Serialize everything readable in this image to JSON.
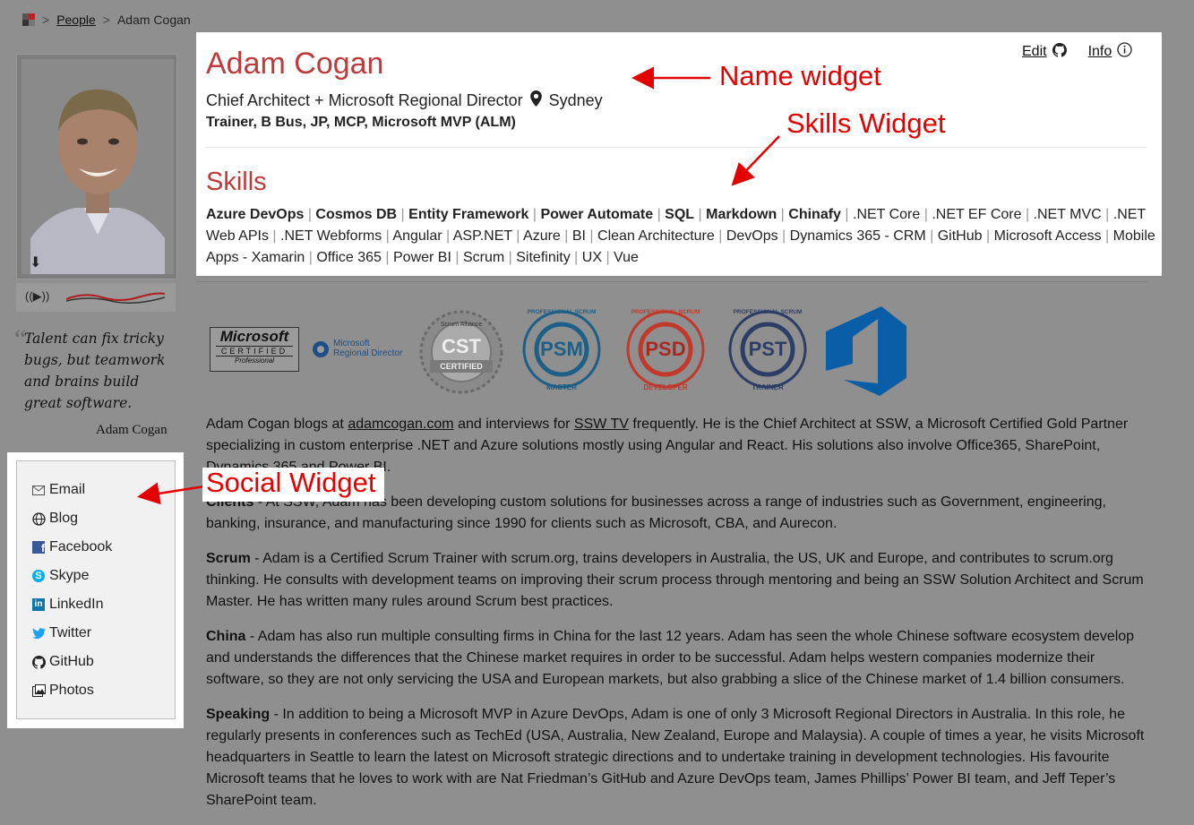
{
  "breadcrumb": {
    "items": [
      "People",
      "Adam Cogan"
    ],
    "separator": ">"
  },
  "profile": {
    "name": "Adam Cogan",
    "role": "Chief Architect + Microsoft Regional Director",
    "location": "Sydney",
    "credentials": "Trainer, B Bus, JP, MCP, Microsoft MVP (ALM)",
    "edit_label": "Edit",
    "info_label": "Info"
  },
  "quote": {
    "text": "Talent can fix tricky bugs, but teamwork and brains build great software.",
    "author": "Adam Cogan"
  },
  "skills": {
    "heading": "Skills",
    "bold_items": [
      "Azure DevOps",
      "Cosmos DB",
      "Entity Framework",
      "Power Automate",
      "SQL",
      "Markdown",
      "Chinafy"
    ],
    "items": [
      ".NET Core",
      ".NET EF Core",
      ".NET MVC",
      ".NET Web APIs",
      ".NET Webforms",
      "Angular",
      "ASP.NET",
      "Azure",
      "BI",
      "Clean Architecture",
      "DevOps",
      "Dynamics 365 - CRM",
      "GitHub",
      "Microsoft Access",
      "Mobile Apps - Xamarin",
      "Office 365",
      "Power BI",
      "Scrum",
      "Sitefinity",
      "UX",
      "Vue"
    ]
  },
  "social": {
    "items": [
      {
        "label": "Email",
        "icon": "email-icon"
      },
      {
        "label": "Blog",
        "icon": "globe-icon"
      },
      {
        "label": "Facebook",
        "icon": "facebook-icon"
      },
      {
        "label": "Skype",
        "icon": "skype-icon"
      },
      {
        "label": "LinkedIn",
        "icon": "linkedin-icon"
      },
      {
        "label": "Twitter",
        "icon": "twitter-icon"
      },
      {
        "label": "GitHub",
        "icon": "github-icon"
      },
      {
        "label": "Photos",
        "icon": "photos-icon"
      }
    ]
  },
  "badges": {
    "microsoft_certified": {
      "line1": "Microsoft",
      "line2": "CERTIFIED",
      "line3": "Professional"
    },
    "regional_director": {
      "line1": "Microsoft",
      "line2": "Regional Director"
    },
    "cst": {
      "top": "Scrum Alliance",
      "mid": "CST",
      "bottom": "CERTIFIED"
    },
    "psm": {
      "top": "PROFESSIONAL SCRUM",
      "mid": "PSM",
      "bottom": "MASTER",
      "color": "#1d5f86"
    },
    "psd": {
      "top": "PROFESSIONAL SCRUM",
      "mid": "PSD",
      "bottom": "DEVELOPER",
      "color": "#c0392b"
    },
    "pst": {
      "top": "PROFESSIONAL SCRUM",
      "mid": "PST",
      "bottom": "TRAINER",
      "color": "#2c3e66"
    },
    "azure_devops_color": "#0a5ea8"
  },
  "bio": {
    "intro_pre": "Adam Cogan blogs at ",
    "intro_link1": "adamcogan.com",
    "intro_mid": " and interviews for ",
    "intro_link2": "SSW TV",
    "intro_post": " frequently. He is the Chief Architect at SSW, a Microsoft Certified Gold Partner specializing in custom enterprise .NET and Azure solutions mostly using Angular and React. His solutions also involve Office365, SharePoint, Dynamics 365 and Power BI.",
    "clients_label": "Clients",
    "clients_text": " - At SSW, Adam has been developing custom solutions for businesses across a range of industries such as Government, engineering, banking, insurance, and manufacturing since 1990 for clients such as Microsoft, CBA, and Aurecon.",
    "scrum_label": "Scrum",
    "scrum_text": " - Adam is a Certified Scrum Trainer with scrum.org, trains developers in Australia, the US, UK and Europe, and contributes to scrum.org thinking. He consults with development teams on improving their scrum process through mentoring and being an SSW Solution Architect and Scrum Master. He has written many rules around Scrum best practices.",
    "china_label": "China",
    "china_text": " - Adam has also run multiple consulting firms in China for the last 12 years. Adam has seen the whole Chinese software ecosystem develop and understands the differences that the Chinese market requires in order to be successful. Adam helps western companies modernize their software, so they are not only servicing the USA and European markets, but also grabbing a slice of the Chinese market of 1.4 billion consumers.",
    "speaking_label": "Speaking",
    "speaking_text": " - In addition to being a Microsoft MVP in Azure DevOps, Adam is one of only 3 Microsoft Regional Directors in Australia. In this role, he regularly presents in conferences such as TechEd (USA, Australia, New Zealand, Europe and Malaysia). A couple of times a year, he visits Microsoft headquarters in Seattle to learn the latest on Microsoft strategic directions and to undertake training in development technologies. His favourite Microsoft teams that he loves to work with are Nat Friedman’s GitHub and Azure DevOps team, James Phillips’ Power BI team, and Jeff Teper’s SharePoint team."
  },
  "annotations": {
    "name_widget": "Name widget",
    "skills_widget": "Skills Widget",
    "social_widget": "Social Widget",
    "color": "#e30000"
  }
}
